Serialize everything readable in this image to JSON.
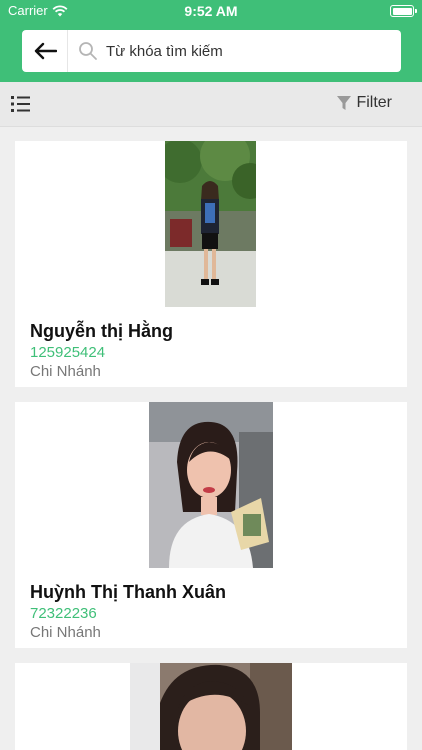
{
  "status_bar": {
    "carrier": "Carrier",
    "time": "9:52 AM"
  },
  "search": {
    "placeholder": "Từ khóa tìm kiếm"
  },
  "toolbar": {
    "filter_label": "Filter"
  },
  "contacts": [
    {
      "name": "Nguyễn thị Hằng",
      "phone": "125925424",
      "branch": "Chi Nhánh"
    },
    {
      "name": "Huỳnh Thị Thanh Xuân",
      "phone": "72322236",
      "branch": "Chi Nhánh"
    },
    {
      "name": "",
      "phone": "",
      "branch": ""
    }
  ],
  "colors": {
    "accent": "#3fbf78",
    "background": "#efefef"
  }
}
